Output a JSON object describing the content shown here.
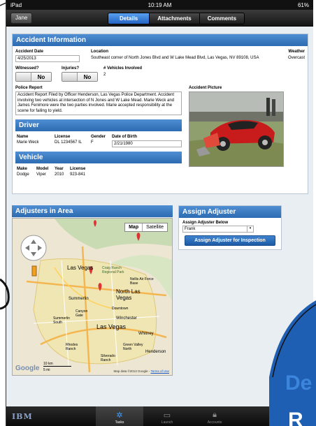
{
  "status_bar": {
    "device": "iPad",
    "time": "10:19 AM",
    "battery": "61%"
  },
  "nav": {
    "back_label": "Jane",
    "tabs": [
      {
        "label": "Details",
        "active": true
      },
      {
        "label": "Attachments",
        "active": false
      },
      {
        "label": "Comments",
        "active": false
      }
    ]
  },
  "accident": {
    "header": "Accident Information",
    "date_label": "Accident Date",
    "date_value": "4/25/2013",
    "location_label": "Location",
    "location_value": "Southeast corner of North Jones Blvd and W Lake Mead Blvd, Las Vegas, NV 89108, USA",
    "weather_label": "Weather",
    "weather_value": "Overcast",
    "witnessed_label": "Witnessed?",
    "witnessed_value": "No",
    "injuries_label": "Injuries?",
    "injuries_value": "No",
    "vehicles_label": "# Vehicles Involved",
    "vehicles_value": "2",
    "police_label": "Police Report",
    "police_value": "Accident Report Filed by Officer Henderson, Las Vegas Police Department. Accident involving two vehicles at intersection of N Jones and W Lake Mead. Marie Weck and James Fenimore were the two parties involved. Marie accepted responsibility at the scene for failing to yield.",
    "picture_label": "Accident Picture"
  },
  "driver": {
    "header": "Driver",
    "name_label": "Name",
    "name_value": "Marie Weck",
    "license_label": "License",
    "license_value": "DL 1234567 IL",
    "gender_label": "Gender",
    "gender_value": "F",
    "dob_label": "Date of Birth",
    "dob_value": "2/21/1980"
  },
  "vehicle": {
    "header": "Vehicle",
    "make_label": "Make",
    "make_value": "Dodge",
    "model_label": "Model",
    "model_value": "Viper",
    "year_label": "Year",
    "year_value": "2010",
    "license_label": "License",
    "license_value": "923-841"
  },
  "adjusters": {
    "header": "Adjusters in Area",
    "map_btn": "Map",
    "satellite_btn": "Satellite",
    "places": [
      "Las Vegas",
      "Craig Ranch Regional Park",
      "Nellis Air Force Base",
      "North Las Vegas",
      "Summerlin",
      "Canyon Gate",
      "Summerlin South",
      "Downtown",
      "Winchester",
      "Las Vegas",
      "Whitney",
      "Rhodes Ranch",
      "Green Valley North",
      "Henderson",
      "Silverado Ranch"
    ],
    "scale_km": "10 km",
    "scale_mi": "5 mi",
    "copyright": "Map data ©2013 Google - ",
    "terms": "Terms of Use",
    "google": "Google"
  },
  "assign": {
    "header": "Assign Adjuster",
    "below_label": "Assign Adjuster Below",
    "selected": "Frank",
    "button": "Assign Adjuster for Inspection"
  },
  "tabbar": {
    "brand": "IBM",
    "tabs": [
      {
        "label": "Tasks",
        "selected": true
      },
      {
        "label": "Launch",
        "selected": false
      },
      {
        "label": "Accounts",
        "selected": false
      }
    ]
  },
  "overlay_text": {
    "line1": "De",
    "line2": "R"
  },
  "colors": {
    "header_blue": "#3b7cc4",
    "nav_active": "#2f73d4",
    "button_blue": "#2a6cbf"
  }
}
